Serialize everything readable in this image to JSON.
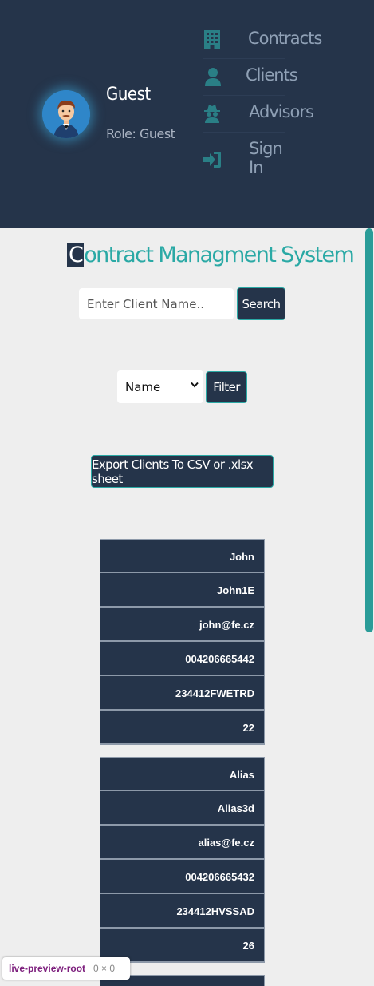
{
  "user": {
    "name": "Guest",
    "role": "Role: Guest"
  },
  "nav": [
    {
      "label": "Contracts",
      "icon": "building-icon"
    },
    {
      "label": "Clients",
      "icon": "user-icon"
    },
    {
      "label": "Advisors",
      "icon": "spy-icon"
    },
    {
      "label": "Sign In",
      "icon": "sign-in-icon"
    }
  ],
  "main": {
    "title_first": "C",
    "title_rest": "ontract Managment System",
    "search": {
      "placeholder": "Enter Client Name..",
      "button": "Search"
    },
    "filter": {
      "selected": "Name",
      "button": "Filter"
    },
    "export_button": "Export Clients To CSV or .xlsx sheet"
  },
  "clients": [
    [
      "John",
      "John1E",
      "john@fe.cz",
      "004206665442",
      "234412FWETRD",
      "22"
    ],
    [
      "Alias",
      "Alias3d",
      "alias@fe.cz",
      "004206665432",
      "234412HVSSAD",
      "26"
    ]
  ],
  "badge": {
    "label": "live-preview-root",
    "size": "0 × 0"
  },
  "colors": {
    "header": "#25344a",
    "accent": "#2aa9a5",
    "background": "#eeeeee"
  }
}
